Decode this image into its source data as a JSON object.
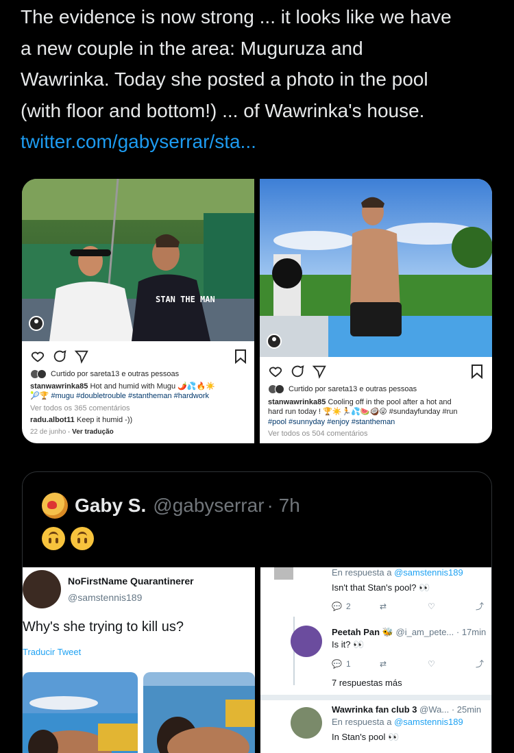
{
  "tweet": {
    "lines": [
      "The evidence is now strong ... it looks like we have",
      "a new couple in the area: Muguruza and",
      "Wawrinka. Today she posted a photo in the pool",
      "(with floor and bottom!) ... of Wawrinka's house."
    ],
    "link": "twitter.com/gabyserrar/sta..."
  },
  "instagram_left": {
    "liked_by": "Curtido por sareta13 e outras pessoas",
    "username": "stanwawrinka85",
    "caption": "Hot and humid with Mugu 🌶️💦🔥☀️",
    "caption2": "🎾🏆 #mugu #doubletrouble #stantheman #hardwork",
    "view_comments": "Ver todos os 365 comentários",
    "comment_user": "radu.albot11",
    "comment_text": "Keep it humid -))",
    "date": "22 de junho",
    "translate": "Ver tradução",
    "shirt_text": "STAN THE MAN"
  },
  "instagram_right": {
    "liked_by": "Curtido por sareta13 e outras pessoas",
    "username": "stanwawrinka85",
    "caption": "Cooling off in the pool after a hot and",
    "caption2": "hard run today ! 🏆☀️🏃💦🍉🥥😜 #sundayfunday #run",
    "caption3": "#pool #sunnyday #enjoy #stantheman",
    "view_comments": "Ver todos os 504 comentários"
  },
  "quote": {
    "name": "Gaby S.",
    "handle": "@gabyserrar",
    "time": "· 7h",
    "emoji_label": "upside-down faces"
  },
  "qt_left": {
    "name": "NoFirstName Quarantinerer",
    "handle": "@samstennis189",
    "text": "Why's she trying to kill us?",
    "translate": "Traducir Tweet"
  },
  "qt_right": {
    "reply1_prefix": "En respuesta a",
    "reply1_target": "@samstennis189",
    "reply1_text": "Isn't that Stan's pool? 👀",
    "reply1_count": "2",
    "reply2_name": "Peetah Pan 🐝",
    "reply2_handle": "@i_am_pete...",
    "reply2_time": "· 17min",
    "reply2_text": "Is it? 👀",
    "reply2_count": "1",
    "more_replies": "7 respuestas más",
    "reply3_name": "Wawrinka fan club 3",
    "reply3_handle": "@Wa...",
    "reply3_time": "· 25min",
    "reply3_prefix": "En respuesta a",
    "reply3_target": "@samstennis189",
    "reply3_text": "In Stan's pool 👀"
  },
  "colors": {
    "background": "#000000",
    "link": "#1d9bf0",
    "text": "#e7e9ea",
    "muted": "#71767b"
  }
}
